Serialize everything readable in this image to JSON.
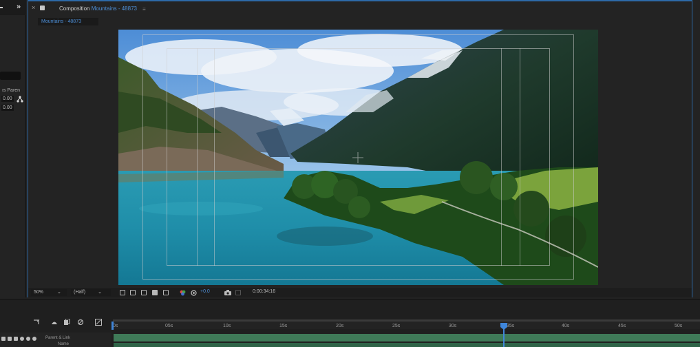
{
  "left_panel": {
    "expand_glyph": "»",
    "partial_label": "ıs Paren",
    "values": [
      "0.00",
      "0.00"
    ]
  },
  "composition": {
    "tab_label": "Composition",
    "comp_name": "Mountains - 48873",
    "tab_close": "×",
    "tab_menu": "≡",
    "chip_label": "Mountains - 48873"
  },
  "viewer_footer": {
    "zoom": "50%",
    "zoom_arrow": "⌄",
    "resolution": "(Half)",
    "resolution_arrow": "⌄",
    "exposure": "+0.0",
    "timecode": "0:00:34:16"
  },
  "timeline": {
    "ruler_labels": [
      "0s",
      "05s",
      "10s",
      "15s",
      "20s",
      "25s",
      "30s",
      "35s",
      "40s",
      "45s",
      "50s"
    ],
    "header_parent": "Parent & Link",
    "header_name": "Name",
    "current_time_seconds": 34.6
  },
  "colors": {
    "accent": "#2d6aa8",
    "cti": "#3f86da",
    "track": "#3f7a58"
  }
}
